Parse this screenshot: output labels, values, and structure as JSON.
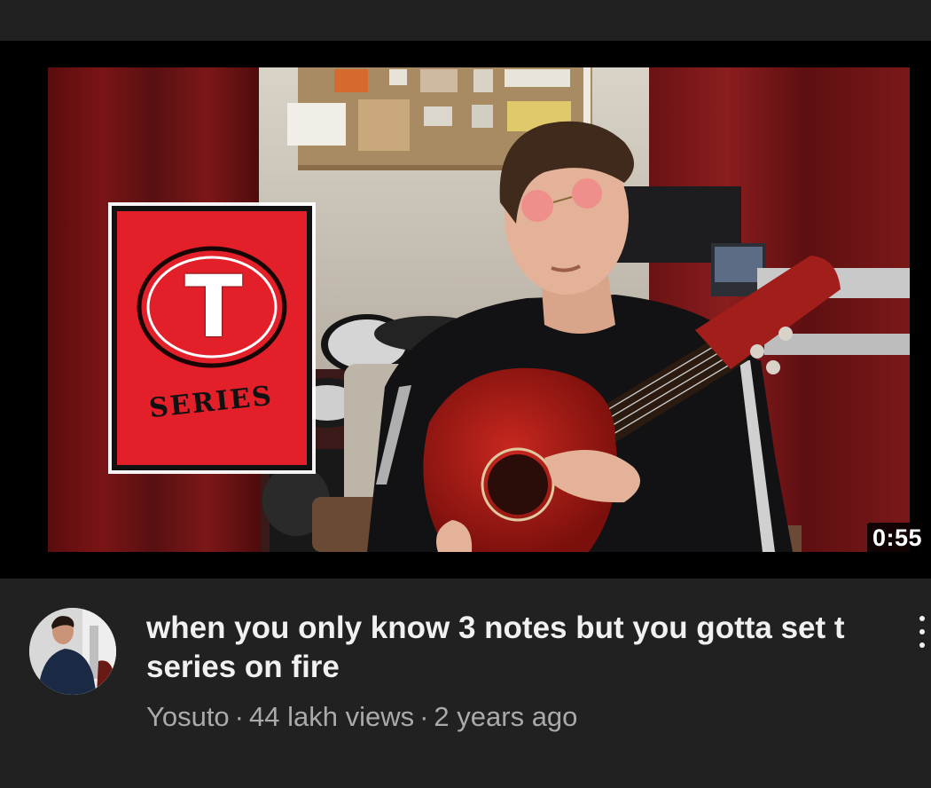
{
  "video": {
    "duration": "0:55",
    "thumbnail": {
      "logo_letter": "T",
      "logo_text": "SERIES",
      "brand_red": "#e3202a"
    },
    "title": "when you only know 3 notes but you gotta set t series on fire",
    "channel": "Yosuto",
    "views": "44 lakh views",
    "age": "2 years ago",
    "separator": "·"
  },
  "icons": {
    "menu": "more-vertical-icon"
  },
  "colors": {
    "background": "#212121",
    "title": "#f1f1f1",
    "meta": "#aaaaaa"
  }
}
